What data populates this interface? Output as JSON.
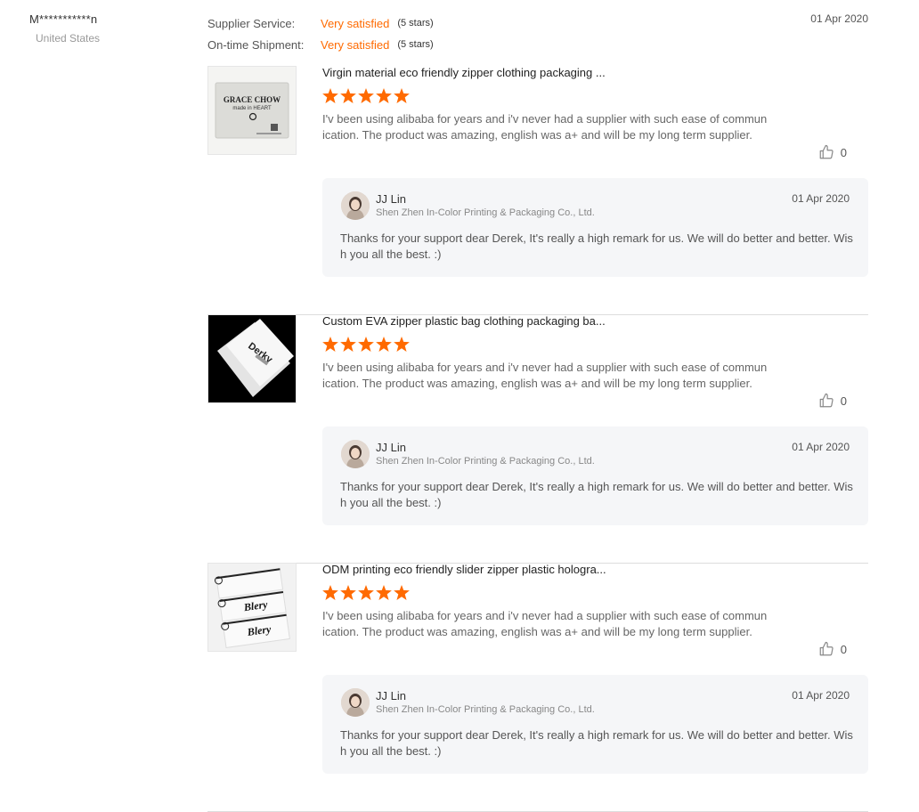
{
  "reviewer": {
    "name": "M***********n",
    "country": "United States"
  },
  "ratings": [
    {
      "label": "Supplier Service:",
      "value": "Very satisfied",
      "stars": "(5 stars)"
    },
    {
      "label": "On-time Shipment:",
      "value": "Very satisfied",
      "stars": "(5 stars)"
    }
  ],
  "review_date": "01 Apr 2020",
  "items": [
    {
      "title": "Virgin material eco friendly zipper clothing packaging ...",
      "rating": 5,
      "comment": "I'v been using alibaba for years and i'v never had a supplier with such ease of communication. The product was amazing, english was a+ and will be my long term supplier.",
      "likes": "0",
      "thumb": {
        "brand": "GRACE CHOW",
        "tagline": "made in HEART"
      },
      "reply": {
        "name": "JJ Lin",
        "company": "Shen Zhen In-Color Printing & Packaging Co., Ltd.",
        "date": "01 Apr 2020",
        "text": "Thanks for your support dear Derek, It's really a high remark for us. We will do better and better. Wish you all the best. :)"
      }
    },
    {
      "title": "Custom EVA zipper plastic bag clothing packaging ba...",
      "rating": 5,
      "comment": "I'v been using alibaba for years and i'v never had a supplier with such ease of communication. The product was amazing, english was a+ and will be my long term supplier.",
      "likes": "0",
      "thumb": {
        "brand": "Derky"
      },
      "reply": {
        "name": "JJ Lin",
        "company": "Shen Zhen In-Color Printing & Packaging Co., Ltd.",
        "date": "01 Apr 2020",
        "text": "Thanks for your support dear Derek, It's really a high remark for us. We will do better and better. Wish you all the best. :)"
      }
    },
    {
      "title": "ODM printing eco friendly slider zipper plastic hologra...",
      "rating": 5,
      "comment": "I'v been using alibaba for years and i'v never had a supplier with such ease of communication. The product was amazing, english was a+ and will be my long term supplier.",
      "likes": "0",
      "thumb": {
        "brand": "Blery"
      },
      "reply": {
        "name": "JJ Lin",
        "company": "Shen Zhen In-Color Printing & Packaging Co., Ltd.",
        "date": "01 Apr 2020",
        "text": "Thanks for your support dear Derek, It's really a high remark for us. We will do better and better. Wish you all the best. :)"
      }
    }
  ],
  "colors": {
    "accent": "#ff6a00",
    "reply_bg": "#f5f6f8",
    "divider": "#dddddd"
  },
  "icons": {
    "like": "thumbs-up-icon",
    "star": "star-icon"
  }
}
